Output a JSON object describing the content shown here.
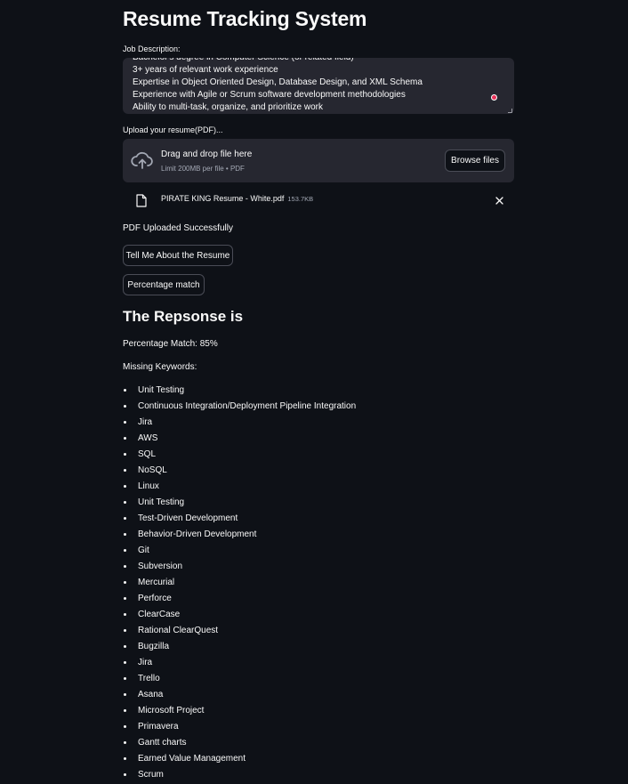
{
  "app": {
    "title": "Resume Tracking System"
  },
  "job_description": {
    "label": "Job Description:",
    "lines": [
      "Bachelor's degree in Computer Science (or related field)",
      "3+ years of relevant work experience",
      "Expertise in Object Oriented Design, Database Design, and XML Schema",
      "Experience with Agile or Scrum software development methodologies",
      "Ability to multi-task, organize, and prioritize work"
    ]
  },
  "upload": {
    "label": "Upload your resume(PDF)...",
    "drop_text": "Drag and drop file here",
    "limit_text": "Limit 200MB per file • PDF",
    "browse_label": "Browse files",
    "icon": "cloud-upload-icon",
    "file": {
      "name": "PIRATE KING Resume - White.pdf",
      "size": "153.7KB",
      "icon": "file-icon"
    },
    "status": "PDF Uploaded Successfully"
  },
  "buttons": {
    "tell_me": "Tell Me About the Resume",
    "percentage": "Percentage match"
  },
  "response": {
    "heading": "The Repsonse is",
    "percentage_line": "Percentage Match: 85%",
    "missing_label": "Missing Keywords:",
    "keywords": [
      "Unit Testing",
      "Continuous Integration/Deployment Pipeline Integration",
      "Jira",
      "AWS",
      "SQL",
      "NoSQL",
      "Linux",
      "Unit Testing",
      "Test-Driven Development",
      "Behavior-Driven Development",
      "Git",
      "Subversion",
      "Mercurial",
      "Perforce",
      "ClearCase",
      "Rational ClearQuest",
      "Bugzilla",
      "Jira",
      "Trello",
      "Asana",
      "Microsoft Project",
      "Primavera",
      "Gantt charts",
      "Earned Value Management",
      "Scrum"
    ]
  },
  "colors": {
    "background": "#0e1117",
    "widget": "#262730",
    "text": "#fafafa",
    "muted": "#a3a8b4",
    "accent": "#e8325a"
  }
}
